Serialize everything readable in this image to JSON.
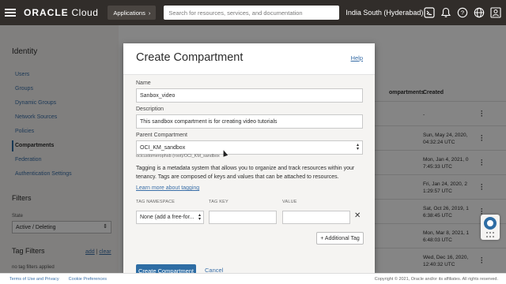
{
  "topbar": {
    "logo_brand": "ORACLE",
    "logo_product": "Cloud",
    "applications_label": "Applications",
    "search_placeholder": "Search for resources, services, and documentation",
    "region_label": "India South (Hyderabad)",
    "icons": [
      "cloud-shell-icon",
      "bell-icon",
      "help-icon",
      "globe-icon",
      "user-icon"
    ]
  },
  "sidebar": {
    "title": "Identity",
    "items": [
      {
        "label": "Users"
      },
      {
        "label": "Groups"
      },
      {
        "label": "Dynamic Groups"
      },
      {
        "label": "Network Sources"
      },
      {
        "label": "Policies"
      },
      {
        "label": "Compartments",
        "active": true
      },
      {
        "label": "Federation"
      },
      {
        "label": "Authentication Settings"
      }
    ],
    "filters_title": "Filters",
    "state_label": "State",
    "state_value": "Active / Deleting",
    "tag_filters_title": "Tag Filters",
    "add_label": "add",
    "separator": "|",
    "clear_label": "clear",
    "no_tags": "no tag filters applied"
  },
  "background_table": {
    "header_partial": "ompartments",
    "header_created": "Created",
    "rows": [
      {
        "created_lines": [
          "-"
        ]
      },
      {
        "created_lines": [
          "Sun, May 24, 2020,",
          "04:32:24 UTC"
        ]
      },
      {
        "created_lines": [
          "Mon, Jan 4, 2021, 0",
          "7:45:33 UTC"
        ]
      },
      {
        "created_lines": [
          "Fri, Jan 24, 2020, 2",
          "1:29:57 UTC"
        ]
      },
      {
        "created_lines": [
          "Sat, Oct 26, 2019, 1",
          "6:38:45 UTC"
        ]
      },
      {
        "created_lines": [
          "Mon, Mar 8, 2021, 1",
          "6:48:03 UTC"
        ]
      },
      {
        "created_lines": [
          "Wed, Dec 16, 2020,",
          "12:40:32 UTC"
        ]
      }
    ]
  },
  "modal": {
    "title": "Create Compartment",
    "help_link": "Help",
    "name_label": "Name",
    "name_value": "Sanbox_video",
    "description_label": "Description",
    "description_value": "This sandbox compartment is for creating video tutorials",
    "parent_label": "Parent Compartment",
    "parent_value": "OCI_KM_sandbox",
    "parent_path": "ocicustomerophsb (root)/OCI_KM_sandbox",
    "tagging_info": "Tagging is a metadata system that allows you to organize and track resources within your tenancy. Tags are composed of keys and values that can be attached to resources.",
    "learn_more": "Learn more about tagging",
    "tag_namespace_header": "TAG NAMESPACE",
    "tag_key_header": "TAG KEY",
    "value_header": "VALUE",
    "tag_namespace_value": "None (add a free-for...",
    "tag_key_value": "",
    "tag_value": "",
    "additional_tag": "+ Additional Tag",
    "create_button": "Create Compartment",
    "cancel_link": "Cancel"
  },
  "footer": {
    "terms": "Terms of Use and Privacy",
    "cookies": "Cookie Preferences",
    "copyright": "Copyright © 2021, Oracle and/or its affiliates. All rights reserved."
  },
  "colors": {
    "topbar": "#312d2a",
    "link": "#3a6fa8",
    "primary_button": "#2e6da4",
    "overlay": "rgba(0,0,0,0.48)"
  }
}
